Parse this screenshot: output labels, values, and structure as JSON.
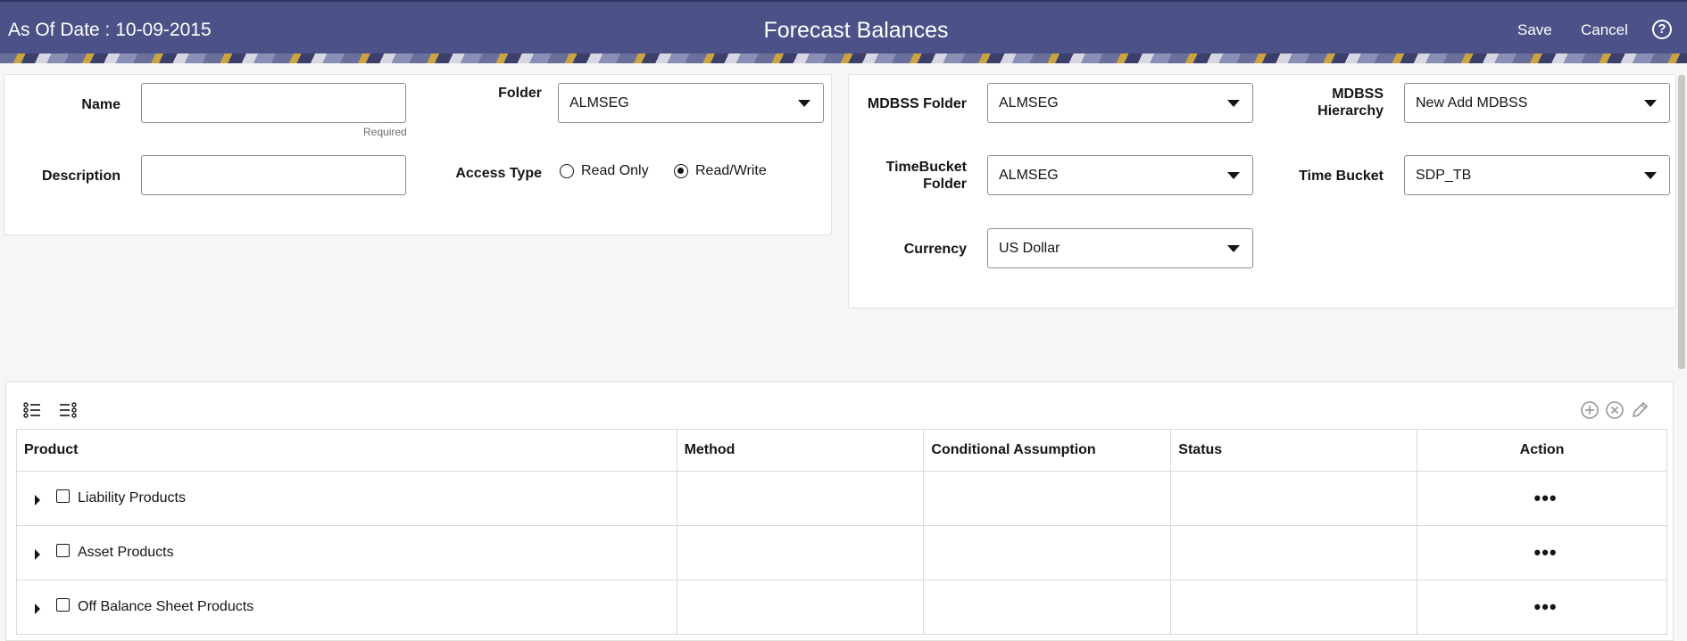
{
  "header": {
    "as_of": "As Of Date : 10-09-2015",
    "title": "Forecast Balances",
    "save": "Save",
    "cancel": "Cancel",
    "help_icon": "?"
  },
  "form_left": {
    "name_label": "Name",
    "name_value": "",
    "required_hint": "Required",
    "description_label": "Description",
    "description_value": "",
    "folder_label": "Folder",
    "folder_value": "ALMSEG",
    "access_type_label": "Access Type",
    "access_options": [
      "Read Only",
      "Read/Write"
    ],
    "access_selected": "Read/Write"
  },
  "form_right": {
    "mdbss_folder_label": "MDBSS Folder",
    "mdbss_folder_value": "ALMSEG",
    "mdbss_hierarchy_label_1": "MDBSS",
    "mdbss_hierarchy_label_2": "Hierarchy",
    "mdbss_hierarchy_value": "New Add MDBSS",
    "timebucket_folder_label_1": "TimeBucket",
    "timebucket_folder_label_2": "Folder",
    "timebucket_folder_value": "ALMSEG",
    "time_bucket_label": "Time Bucket",
    "time_bucket_value": "SDP_TB",
    "currency_label": "Currency",
    "currency_value": "US Dollar"
  },
  "table": {
    "columns": [
      "Product",
      "Method",
      "Conditional Assumption",
      "Status",
      "Action"
    ],
    "rows": [
      {
        "product": "Liability Products",
        "method": "",
        "conditional": "",
        "status": "",
        "action": "•••"
      },
      {
        "product": "Asset Products",
        "method": "",
        "conditional": "",
        "status": "",
        "action": "•••"
      },
      {
        "product": "Off Balance Sheet Products",
        "method": "",
        "conditional": "",
        "status": "",
        "action": "•••"
      }
    ]
  },
  "colors": {
    "header_bg": "#4c5287",
    "accent_gold": "#c9a441"
  }
}
